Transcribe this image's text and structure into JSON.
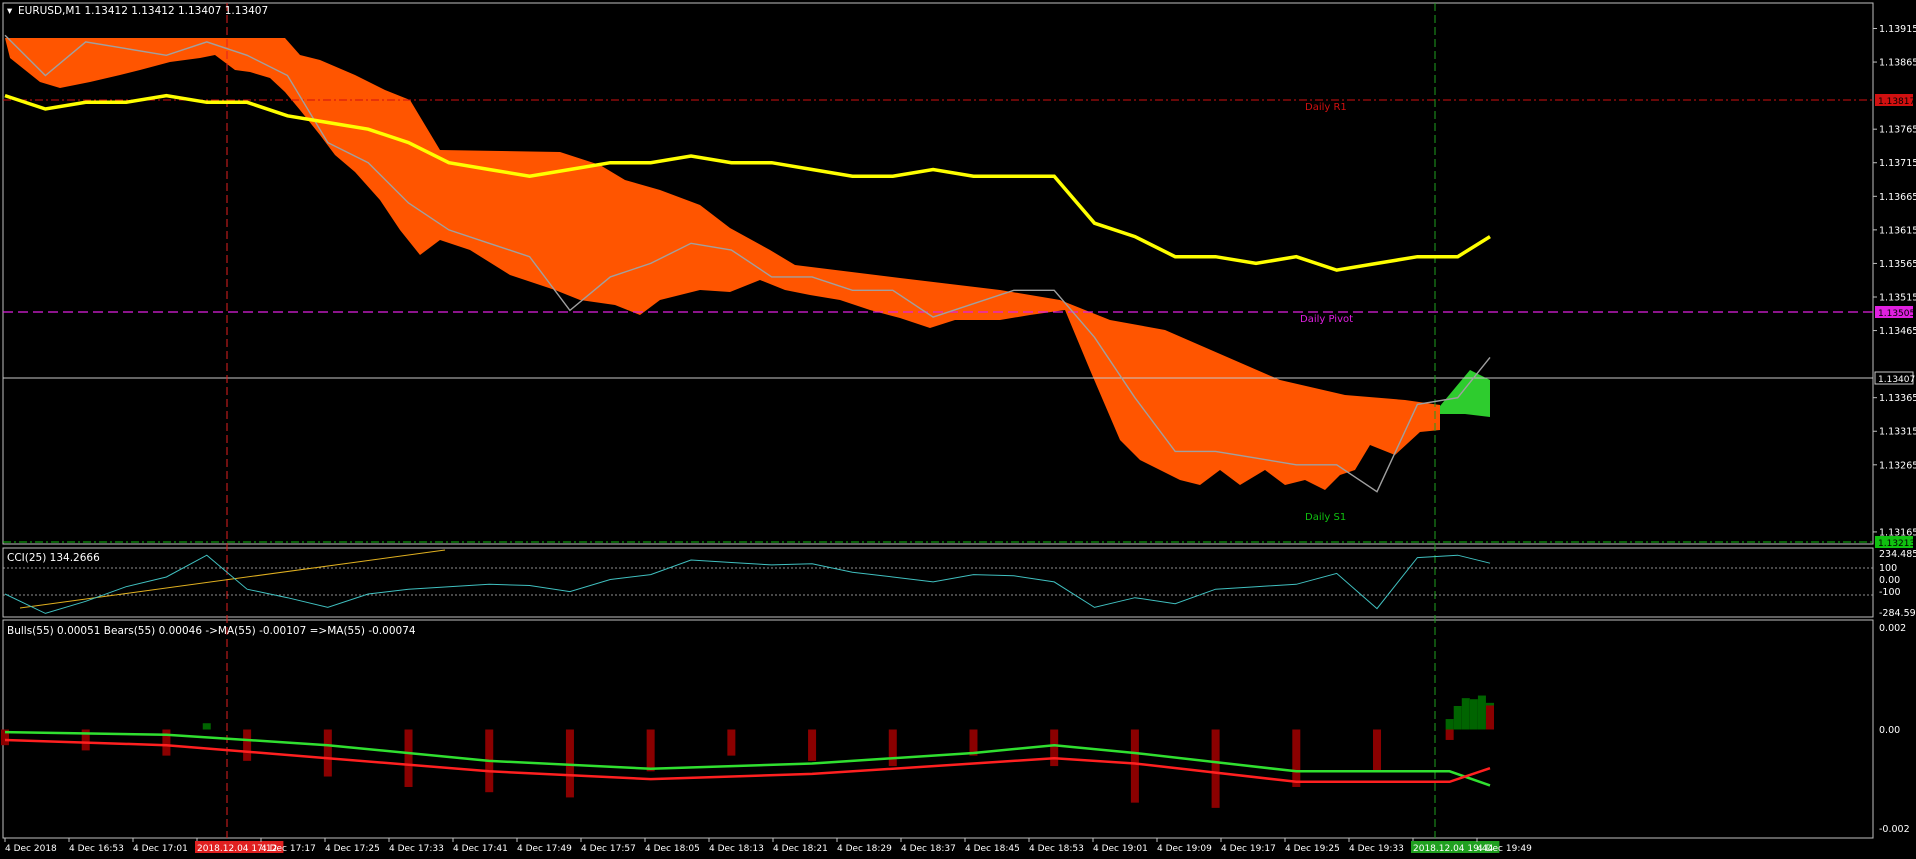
{
  "panes": {
    "main": {
      "title": "EURUSD,M1  1.13412 1.13412 1.13407 1.13407",
      "price_ticks": [
        "1.13915",
        "1.13865",
        "1.13765",
        "1.13715",
        "1.13665",
        "1.13615",
        "1.13565",
        "1.13515",
        "1.13465",
        "1.13365",
        "1.13315",
        "1.13265",
        "1.13165"
      ],
      "current_price": "1.13407",
      "levels": [
        {
          "name": "Daily R1",
          "price": 1.13817,
          "tag": "1.13817",
          "color": "#d01010",
          "style": "dashdot"
        },
        {
          "name": "Daily Pivot",
          "price": 1.13505,
          "tag": "1.13505",
          "color": "#e020e0",
          "style": "dash"
        },
        {
          "name": "Daily S1",
          "price": 1.13213,
          "tag": "1.13213",
          "color": "#10c010",
          "style": "dashdot"
        }
      ]
    },
    "cci": {
      "title": "CCI(25) 134.2666",
      "ticks": [
        "234.4853",
        "100",
        "0.00",
        "-100",
        "-284.5985"
      ]
    },
    "bulls_bears": {
      "title": "Bulls(55) 0.00051  Bears(55) 0.00046  ->MA(55) -0.00107  =>MA(55) -0.00074",
      "ticks": [
        "0.002",
        "0.00",
        "-0.002"
      ]
    }
  },
  "time_axis": {
    "labels": [
      "4 Dec 2018",
      "4 Dec 16:53",
      "4 Dec 17:01",
      "2018.12.04 17:12",
      "4 Dec 17:17",
      "4 Dec 17:25",
      "4 Dec 17:33",
      "4 Dec 17:41",
      "4 Dec 17:49",
      "4 Dec 17:57",
      "4 Dec 18:05",
      "4 Dec 18:13",
      "4 Dec 18:21",
      "4 Dec 18:29",
      "4 Dec 18:37",
      "4 Dec 18:45",
      "4 Dec 18:53",
      "4 Dec 19:01",
      "4 Dec 19:09",
      "4 Dec 19:17",
      "4 Dec 19:25",
      "4 Dec 19:33",
      "2018.12.04 19:44",
      "4 Dec 19:49"
    ],
    "highlighted": [
      {
        "label": "2018.12.04 17:12",
        "color": "#e02020"
      },
      {
        "label": "2018.12.04 19:44",
        "color": "#20a020"
      }
    ]
  },
  "chart_data": [
    {
      "type": "line",
      "pane": "main",
      "series": [
        {
          "name": "close",
          "color": "#a0a0a0",
          "x": [
            "16:45",
            "16:50",
            "16:55",
            "17:00",
            "17:05",
            "17:10",
            "17:15",
            "17:20",
            "17:25",
            "17:30",
            "17:35",
            "17:40",
            "17:45",
            "17:50",
            "17:55",
            "18:00",
            "18:05",
            "18:10",
            "18:15",
            "18:20",
            "18:25",
            "18:30",
            "18:35",
            "18:40",
            "18:45",
            "18:50",
            "18:55",
            "19:00",
            "19:05",
            "19:10",
            "19:15",
            "19:20",
            "19:25",
            "19:30",
            "19:35",
            "19:40",
            "19:45",
            "19:49"
          ],
          "values": [
            1.13905,
            1.13845,
            1.13895,
            1.13885,
            1.13875,
            1.13895,
            1.13875,
            1.13845,
            1.13745,
            1.13715,
            1.13655,
            1.13615,
            1.13595,
            1.13575,
            1.13495,
            1.13545,
            1.13565,
            1.13595,
            1.13585,
            1.13545,
            1.13545,
            1.13525,
            1.13525,
            1.13485,
            1.13505,
            1.13525,
            1.13525,
            1.13455,
            1.13365,
            1.13285,
            1.13285,
            1.13275,
            1.13265,
            1.13265,
            1.13225,
            1.13355,
            1.13365,
            1.13425
          ]
        },
        {
          "name": "ma",
          "color": "#ffff00",
          "x": [
            "16:45",
            "16:50",
            "16:55",
            "17:00",
            "17:05",
            "17:10",
            "17:15",
            "17:20",
            "17:25",
            "17:30",
            "17:35",
            "17:40",
            "17:45",
            "17:50",
            "17:55",
            "18:00",
            "18:05",
            "18:10",
            "18:15",
            "18:20",
            "18:25",
            "18:30",
            "18:35",
            "18:40",
            "18:45",
            "18:50",
            "18:55",
            "19:00",
            "19:05",
            "19:10",
            "19:15",
            "19:20",
            "19:25",
            "19:30",
            "19:35",
            "19:40",
            "19:45",
            "19:49"
          ],
          "values": [
            1.13815,
            1.13795,
            1.13805,
            1.13805,
            1.13815,
            1.13805,
            1.13805,
            1.13785,
            1.13775,
            1.13765,
            1.13745,
            1.13715,
            1.13705,
            1.13695,
            1.13705,
            1.13715,
            1.13715,
            1.13725,
            1.13715,
            1.13715,
            1.13705,
            1.13695,
            1.13695,
            1.13705,
            1.13695,
            1.13695,
            1.13695,
            1.13625,
            1.13605,
            1.13575,
            1.13575,
            1.13565,
            1.13575,
            1.13555,
            1.13565,
            1.13575,
            1.13575,
            1.13605
          ]
        }
      ],
      "ylim": [
        1.1315,
        1.1395
      ]
    },
    {
      "type": "line",
      "pane": "cci",
      "series": [
        {
          "name": "CCI(25)",
          "color": "#40c0c0",
          "x": [
            "16:45",
            "16:50",
            "16:55",
            "17:00",
            "17:05",
            "17:10",
            "17:15",
            "17:20",
            "17:25",
            "17:30",
            "17:35",
            "17:40",
            "17:45",
            "17:50",
            "17:55",
            "18:00",
            "18:05",
            "18:10",
            "18:15",
            "18:20",
            "18:25",
            "18:30",
            "18:35",
            "18:40",
            "18:45",
            "18:50",
            "18:55",
            "19:00",
            "19:05",
            "19:10",
            "19:15",
            "19:20",
            "19:25",
            "19:30",
            "19:35",
            "19:40",
            "19:45",
            "19:49"
          ],
          "values": [
            -120,
            -280,
            -180,
            -60,
            20,
            200,
            -80,
            -150,
            -230,
            -120,
            -80,
            -60,
            -40,
            -50,
            -100,
            0,
            40,
            160,
            140,
            120,
            130,
            60,
            20,
            -20,
            40,
            30,
            -20,
            -230,
            -150,
            -200,
            -80,
            -60,
            -40,
            50,
            -240,
            180,
            200,
            134.27
          ]
        }
      ],
      "ylim": [
        -284.5985,
        234.4853
      ]
    },
    {
      "type": "bar",
      "pane": "bulls_bears",
      "series": [
        {
          "name": "Bulls(55)",
          "color": "#006400",
          "x": [
            "17:10",
            "19:44",
            "19:45",
            "19:46",
            "19:47",
            "19:48",
            "19:49"
          ],
          "values": [
            0.00012,
            0.0002,
            0.00045,
            0.0006,
            0.00058,
            0.00065,
            0.00051
          ]
        },
        {
          "name": "Bears(55)",
          "color": "#8b0000",
          "x": [
            "16:45",
            "16:55",
            "17:05",
            "17:15",
            "17:25",
            "17:35",
            "17:45",
            "17:55",
            "18:05",
            "18:15",
            "18:25",
            "18:35",
            "18:45",
            "18:55",
            "19:05",
            "19:15",
            "19:25",
            "19:35",
            "19:44",
            "19:49"
          ],
          "values": [
            -0.0003,
            -0.0004,
            -0.0005,
            -0.0006,
            -0.0009,
            -0.0011,
            -0.0012,
            -0.0013,
            -0.0008,
            -0.0005,
            -0.0006,
            -0.0007,
            -0.0005,
            -0.0007,
            -0.0014,
            -0.0015,
            -0.0011,
            -0.0008,
            -0.0002,
            0.00046
          ]
        },
        {
          "name": "->MA(55)",
          "color": "#30e030",
          "x": [
            "16:45",
            "17:05",
            "17:25",
            "17:45",
            "18:05",
            "18:25",
            "18:45",
            "18:55",
            "19:05",
            "19:25",
            "19:44",
            "19:49"
          ],
          "values": [
            -5e-05,
            -0.0001,
            -0.0003,
            -0.0006,
            -0.00075,
            -0.00065,
            -0.00045,
            -0.0003,
            -0.00045,
            -0.0008,
            -0.0008,
            -0.00107
          ]
        },
        {
          "name": "=>MA(55)",
          "color": "#ff2020",
          "x": [
            "16:45",
            "17:05",
            "17:25",
            "17:45",
            "18:05",
            "18:25",
            "18:45",
            "18:55",
            "19:05",
            "19:25",
            "19:44",
            "19:49"
          ],
          "values": [
            -0.0002,
            -0.0003,
            -0.00055,
            -0.0008,
            -0.00095,
            -0.00085,
            -0.00065,
            -0.00055,
            -0.00065,
            -0.001,
            -0.001,
            -0.00074
          ]
        }
      ],
      "ylim": [
        -0.002,
        0.002
      ]
    }
  ]
}
